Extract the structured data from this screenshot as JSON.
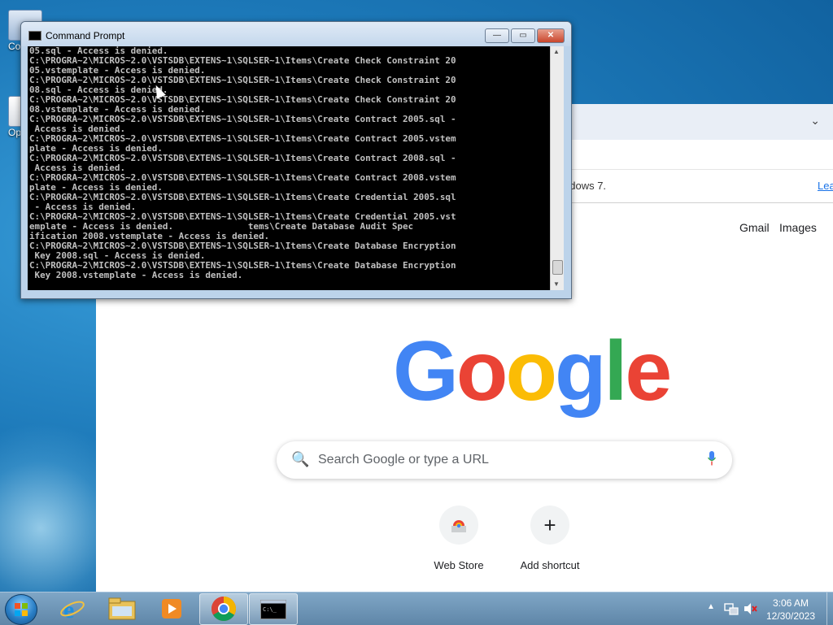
{
  "desktop": {
    "icons": [
      {
        "label": "Co"
      },
      {
        "label": "Op"
      }
    ]
  },
  "cmd_window": {
    "title": "Command Prompt",
    "buttons": {
      "minimize": "—",
      "maximize": "▭",
      "close": "✕"
    },
    "lines": [
      "05.sql - Access is denied.",
      "C:\\PROGRA~2\\MICROS~2.0\\VSTSDB\\EXTENS~1\\SQLSER~1\\Items\\Create Check Constraint 20",
      "05.vstemplate - Access is denied.",
      "C:\\PROGRA~2\\MICROS~2.0\\VSTSDB\\EXTENS~1\\SQLSER~1\\Items\\Create Check Constraint 20",
      "08.sql - Access is denied.",
      "C:\\PROGRA~2\\MICROS~2.0\\VSTSDB\\EXTENS~1\\SQLSER~1\\Items\\Create Check Constraint 20",
      "08.vstemplate - Access is denied.",
      "C:\\PROGRA~2\\MICROS~2.0\\VSTSDB\\EXTENS~1\\SQLSER~1\\Items\\Create Contract 2005.sql -",
      " Access is denied.",
      "C:\\PROGRA~2\\MICROS~2.0\\VSTSDB\\EXTENS~1\\SQLSER~1\\Items\\Create Contract 2005.vstem",
      "plate - Access is denied.",
      "C:\\PROGRA~2\\MICROS~2.0\\VSTSDB\\EXTENS~1\\SQLSER~1\\Items\\Create Contract 2008.sql -",
      " Access is denied.",
      "C:\\PROGRA~2\\MICROS~2.0\\VSTSDB\\EXTENS~1\\SQLSER~1\\Items\\Create Contract 2008.vstem",
      "plate - Access is denied.",
      "C:\\PROGRA~2\\MICROS~2.0\\VSTSDB\\EXTENS~1\\SQLSER~1\\Items\\Create Credential 2005.sql",
      " - Access is denied.",
      "C:\\PROGRA~2\\MICROS~2.0\\VSTSDB\\EXTENS~1\\SQLSER~1\\Items\\Create Credential 2005.vst",
      "emplate - Access is denied.              tems\\Create Database Audit Spec",
      "ification 2008.vstemplate - Access is denied.",
      "C:\\PROGRA~2\\MICROS~2.0\\VSTSDB\\EXTENS~1\\SQLSER~1\\Items\\Create Database Encryption",
      " Key 2008.sql - Access is denied.",
      "C:\\PROGRA~2\\MICROS~2.0\\VSTSDB\\EXTENS~1\\SQLSER~1\\Items\\Create Database Encryption",
      " Key 2008.vstemplate - Access is denied."
    ]
  },
  "chrome": {
    "infobar_message": "ndows 7.",
    "infobar_link": "Lea",
    "top_links": {
      "gmail": "Gmail",
      "images": "Images"
    },
    "logo_letters": [
      {
        "ch": "G",
        "color": "#4285f4"
      },
      {
        "ch": "o",
        "color": "#ea4335"
      },
      {
        "ch": "o",
        "color": "#fbbc05"
      },
      {
        "ch": "g",
        "color": "#4285f4"
      },
      {
        "ch": "l",
        "color": "#34a853"
      },
      {
        "ch": "e",
        "color": "#ea4335"
      }
    ],
    "search_placeholder": "Search Google or type a URL",
    "shortcuts": [
      {
        "label": "Web Store",
        "icon": "web-store-icon"
      },
      {
        "label": "Add shortcut",
        "icon": "plus-icon"
      }
    ]
  },
  "taskbar": {
    "pinned": [
      {
        "name": "internet-explorer-icon",
        "active": false
      },
      {
        "name": "file-explorer-icon",
        "active": false
      },
      {
        "name": "media-player-icon",
        "active": false
      },
      {
        "name": "chrome-icon",
        "active": true
      },
      {
        "name": "command-prompt-icon",
        "active": true
      }
    ],
    "clock": {
      "time": "3:06 AM",
      "date": "12/30/2023"
    }
  }
}
